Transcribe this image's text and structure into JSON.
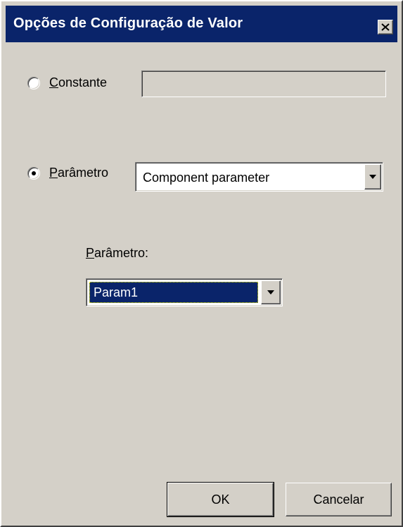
{
  "window": {
    "title": "Opções de Configuração de Valor",
    "close_icon": "close-icon"
  },
  "options": {
    "constant": {
      "label": "Constante",
      "selected": false,
      "value": ""
    },
    "parameter": {
      "label": "Parâmetro",
      "selected": true,
      "type_selected": "Component parameter"
    }
  },
  "parameter_section": {
    "label": "Parâmetro:",
    "selected": "Param1"
  },
  "buttons": {
    "ok": "OK",
    "cancel": "Cancelar"
  },
  "colors": {
    "titlebar": "#0a246a",
    "face": "#d4d0c8",
    "selection": "#0a246a"
  }
}
